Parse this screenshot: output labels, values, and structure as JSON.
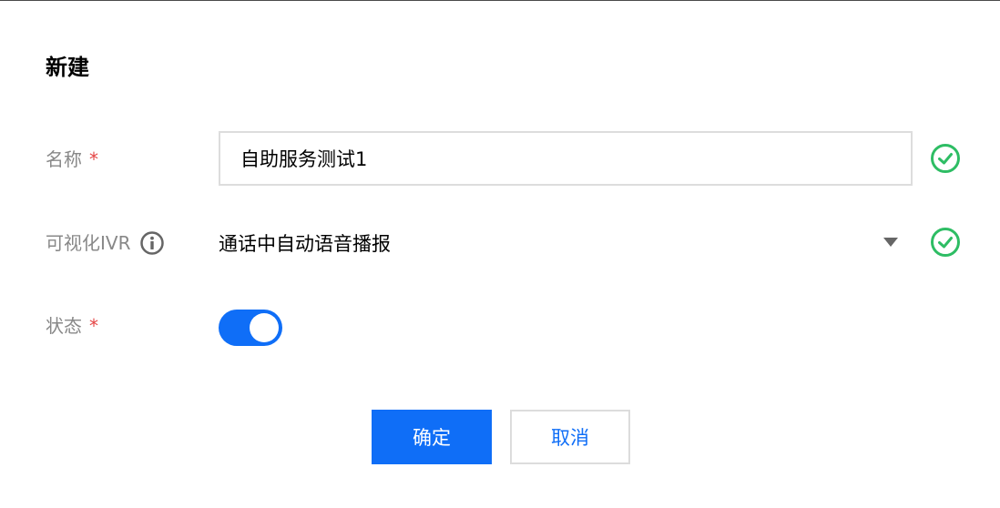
{
  "dialog": {
    "title": "新建"
  },
  "form": {
    "name": {
      "label": "名称",
      "required_mark": "*",
      "value": "自助服务测试1"
    },
    "ivr": {
      "label": "可视化IVR",
      "selected": "通话中自动语音播报"
    },
    "status": {
      "label": "状态",
      "required_mark": "*",
      "enabled": true
    }
  },
  "buttons": {
    "confirm": "确定",
    "cancel": "取消"
  },
  "colors": {
    "primary": "#0f6ef7",
    "success": "#2ebd64",
    "required": "#e54545",
    "label": "#888888"
  },
  "icons": {
    "valid": "check-circle-icon",
    "info": "info-circle-icon",
    "dropdown": "caret-down-icon"
  }
}
